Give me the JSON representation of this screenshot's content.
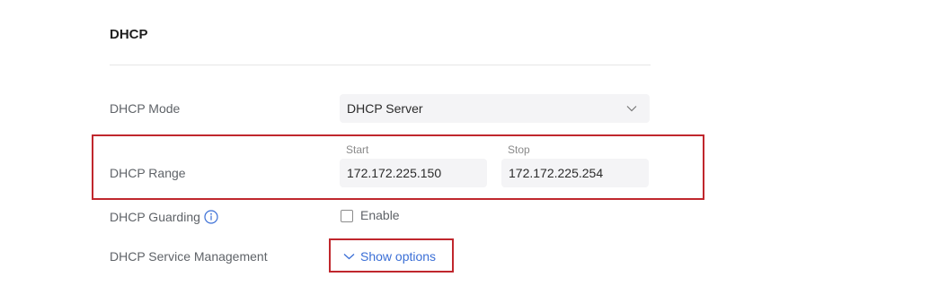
{
  "section": {
    "title": "DHCP"
  },
  "mode": {
    "label": "DHCP Mode",
    "value": "DHCP Server"
  },
  "range": {
    "label": "DHCP Range",
    "start_label": "Start",
    "start_value": "172.172.225.150",
    "stop_label": "Stop",
    "stop_value": "172.172.225.254"
  },
  "guarding": {
    "label": "DHCP Guarding",
    "checkbox_label": "Enable",
    "checked": false
  },
  "service_management": {
    "label": "DHCP Service Management",
    "toggle_label": "Show options"
  },
  "colors": {
    "highlight": "#c0272d",
    "link": "#3b6fd6",
    "field_bg": "#f4f4f6"
  },
  "icons": {
    "select_chevron": "chevron-down-icon",
    "guarding_info": "info-icon",
    "show_options_chevron": "chevron-down-icon"
  }
}
